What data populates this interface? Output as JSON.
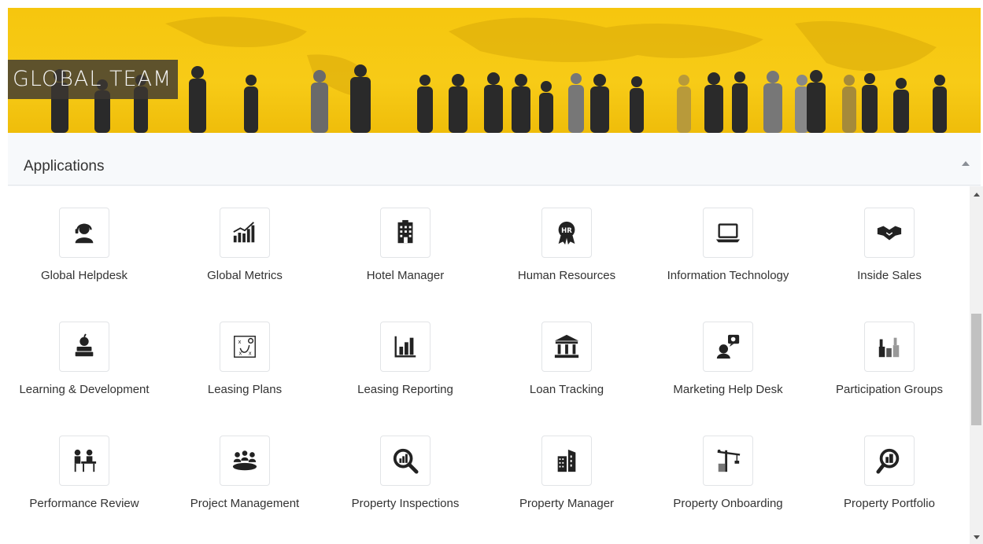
{
  "banner": {
    "title": "GLOBAL TEAM"
  },
  "panel": {
    "title": "Applications"
  },
  "apps": [
    {
      "label": "Global Helpdesk",
      "icon": "helpdesk-agent-icon"
    },
    {
      "label": "Global Metrics",
      "icon": "bar-chart-growth-icon"
    },
    {
      "label": "Hotel Manager",
      "icon": "hotel-building-icon"
    },
    {
      "label": "Human Resources",
      "icon": "hr-badge-icon"
    },
    {
      "label": "Information Technology",
      "icon": "laptop-icon"
    },
    {
      "label": "Inside Sales",
      "icon": "handshake-icon"
    },
    {
      "label": "Learning & Development",
      "icon": "books-apple-icon"
    },
    {
      "label": "Leasing Plans",
      "icon": "strategy-board-icon"
    },
    {
      "label": "Leasing Reporting",
      "icon": "report-chart-icon"
    },
    {
      "label": "Loan Tracking",
      "icon": "bank-icon"
    },
    {
      "label": "Marketing Help Desk",
      "icon": "marketing-support-icon"
    },
    {
      "label": "Participation Groups",
      "icon": "raised-hands-icon"
    },
    {
      "label": "Performance Review",
      "icon": "interview-desk-icon"
    },
    {
      "label": "Project Management",
      "icon": "team-meeting-icon"
    },
    {
      "label": "Property Inspections",
      "icon": "magnify-chart-icon"
    },
    {
      "label": "Property Manager",
      "icon": "office-building-icon"
    },
    {
      "label": "Property Onboarding",
      "icon": "construction-crane-icon"
    },
    {
      "label": "Property Portfolio",
      "icon": "portfolio-search-icon"
    }
  ]
}
